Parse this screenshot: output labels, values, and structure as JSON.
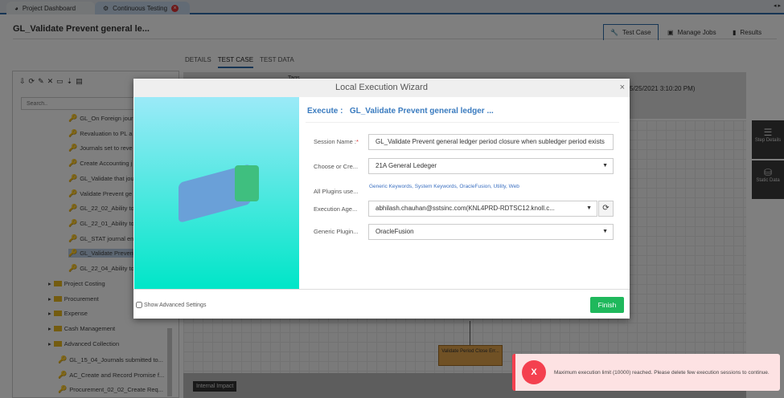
{
  "tabs": [
    {
      "label": "Project Dashboard"
    },
    {
      "label": "Continuous Testing"
    }
  ],
  "header": {
    "title": "GL_Validate Prevent general le...",
    "buttons": [
      "Test Case",
      "Manage Jobs",
      "Results"
    ]
  },
  "subtabs": [
    "DETAILS",
    "TEST CASE",
    "TEST DATA"
  ],
  "left": {
    "search_placeholder": "Search..",
    "tests": [
      "GL_On Foreign journ",
      "Revaluation to PL a",
      "Journals set to reve",
      "Create Accounting j",
      "GL_Validate that jou",
      "Validate Prevent ge",
      "GL_22_02_Ability to",
      "GL_22_01_Ability to",
      "GL_STAT journal ent",
      "GL_Validate Prevent",
      "GL_22_04_Ability to"
    ],
    "folders": [
      "Project Costing",
      "Procurement",
      "Expense",
      "Cash Management",
      "Advanced Collection"
    ],
    "more": [
      "GL_15_04_Journals submitted to...",
      "AC_Create and Record Promise f...",
      "Procurement_02_02_Create Req..."
    ]
  },
  "background": {
    "tags": "Tags",
    "timestamp": "5/25/2021 3:10:20 PM)",
    "node": "Validate Period Close Err...",
    "internal_impact": "Internal Impact",
    "side": [
      "Step Details",
      "Static Data"
    ]
  },
  "modal": {
    "title": "Local Execution Wizard",
    "close": "×",
    "execute_label": "Execute :",
    "execute_name": "GL_Validate Prevent general ledger ...",
    "fields": [
      {
        "label": "Session Name :",
        "required": "*",
        "value": "GL_Validate Prevent general ledger period closure when subledger period exists"
      },
      {
        "label": "Choose or Cre...",
        "value": "21A General Ledeger"
      },
      {
        "label": "All Plugins use...",
        "value": "Generic Keywords, System Keywords, OracleFusion, Utility, Web"
      },
      {
        "label": "Execution Age...",
        "value": "abhilash.chauhan@sstsinc.com(KNL4PRD-RDTSC12.knoll.c..."
      },
      {
        "label": "Generic Plugin...",
        "value": "OracleFusion"
      }
    ],
    "advanced": "Show Advanced Settings",
    "finish": "Finish"
  },
  "toast": {
    "icon": "X",
    "message": "Maximum execution limit (10000) reached. Please delete few execution sessions to continue."
  }
}
